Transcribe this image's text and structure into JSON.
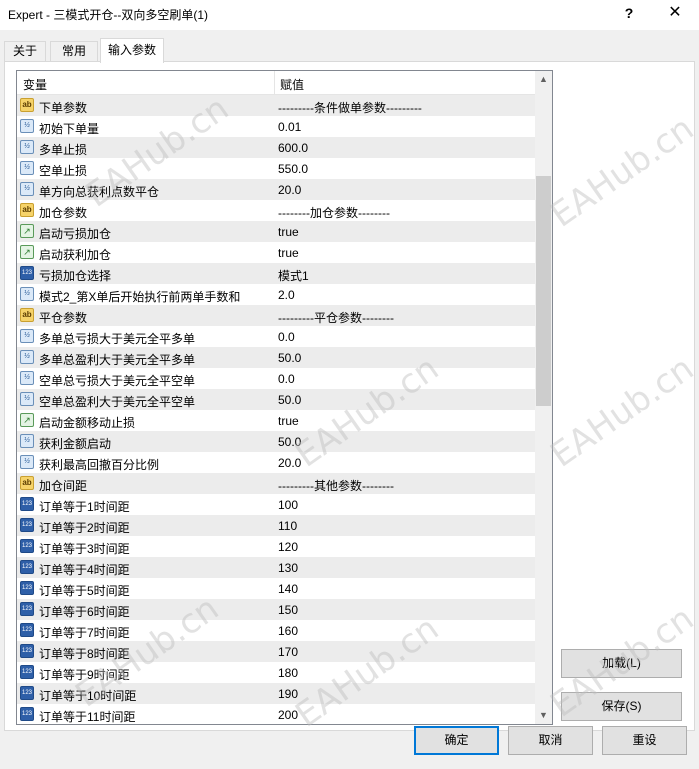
{
  "window": {
    "title": "Expert - 三模式开仓--双向多空刷单(1)",
    "help_label": "?",
    "close_label": "✕"
  },
  "tabs": [
    {
      "label": "关于"
    },
    {
      "label": "常用"
    },
    {
      "label": "输入参数"
    }
  ],
  "grid": {
    "col_variable": "变量",
    "col_value": "赋值",
    "rows": [
      {
        "icon": "ab",
        "name": "下单参数",
        "value": "---------条件做单参数---------"
      },
      {
        "icon": "v2",
        "name": "初始下单量",
        "value": "0.01"
      },
      {
        "icon": "v2",
        "name": "多单止损",
        "value": "600.0"
      },
      {
        "icon": "v2",
        "name": "空单止损",
        "value": "550.0"
      },
      {
        "icon": "v2",
        "name": "单方向总获利点数平仓",
        "value": "20.0"
      },
      {
        "icon": "ab",
        "name": "加仓参数",
        "value": "--------加仓参数--------"
      },
      {
        "icon": "tf",
        "name": "启动亏损加仓",
        "value": "true"
      },
      {
        "icon": "tf",
        "name": "启动获利加仓",
        "value": "true"
      },
      {
        "icon": "n123",
        "name": "亏损加仓选择",
        "value": "模式1"
      },
      {
        "icon": "v2",
        "name": "模式2_第X单后开始执行前两单手数和",
        "value": "2.0"
      },
      {
        "icon": "ab",
        "name": "平仓参数",
        "value": "---------平仓参数--------"
      },
      {
        "icon": "v2",
        "name": "多单总亏损大于美元全平多单",
        "value": "0.0"
      },
      {
        "icon": "v2",
        "name": "多单总盈利大于美元全平多单",
        "value": "50.0"
      },
      {
        "icon": "v2",
        "name": "空单总亏损大于美元全平空单",
        "value": "0.0"
      },
      {
        "icon": "v2",
        "name": "空单总盈利大于美元全平空单",
        "value": "50.0"
      },
      {
        "icon": "tf",
        "name": "启动金额移动止损",
        "value": "true"
      },
      {
        "icon": "v2",
        "name": "获利金额启动",
        "value": "50.0"
      },
      {
        "icon": "v2",
        "name": "获利最高回撤百分比例",
        "value": "20.0"
      },
      {
        "icon": "ab",
        "name": "加仓间距",
        "value": "---------其他参数--------"
      },
      {
        "icon": "n123",
        "name": "订单等于1时间距",
        "value": "100"
      },
      {
        "icon": "n123",
        "name": "订单等于2时间距",
        "value": "110"
      },
      {
        "icon": "n123",
        "name": "订单等于3时间距",
        "value": "120"
      },
      {
        "icon": "n123",
        "name": "订单等于4时间距",
        "value": "130"
      },
      {
        "icon": "n123",
        "name": "订单等于5时间距",
        "value": "140"
      },
      {
        "icon": "n123",
        "name": "订单等于6时间距",
        "value": "150"
      },
      {
        "icon": "n123",
        "name": "订单等于7时间距",
        "value": "160"
      },
      {
        "icon": "n123",
        "name": "订单等于8时间距",
        "value": "170"
      },
      {
        "icon": "n123",
        "name": "订单等于9时间距",
        "value": "180"
      },
      {
        "icon": "n123",
        "name": "订单等于10时间距",
        "value": "190"
      },
      {
        "icon": "n123",
        "name": "订单等于11时间距",
        "value": "200"
      }
    ]
  },
  "icon_glyphs": {
    "ab": "ab",
    "v2": "½",
    "tf": "↗",
    "n123": "123"
  },
  "buttons": {
    "load": "加载(L)",
    "save": "保存(S)",
    "ok": "确定",
    "cancel": "取消",
    "reset": "重设"
  },
  "watermark": "EAHub.cn"
}
